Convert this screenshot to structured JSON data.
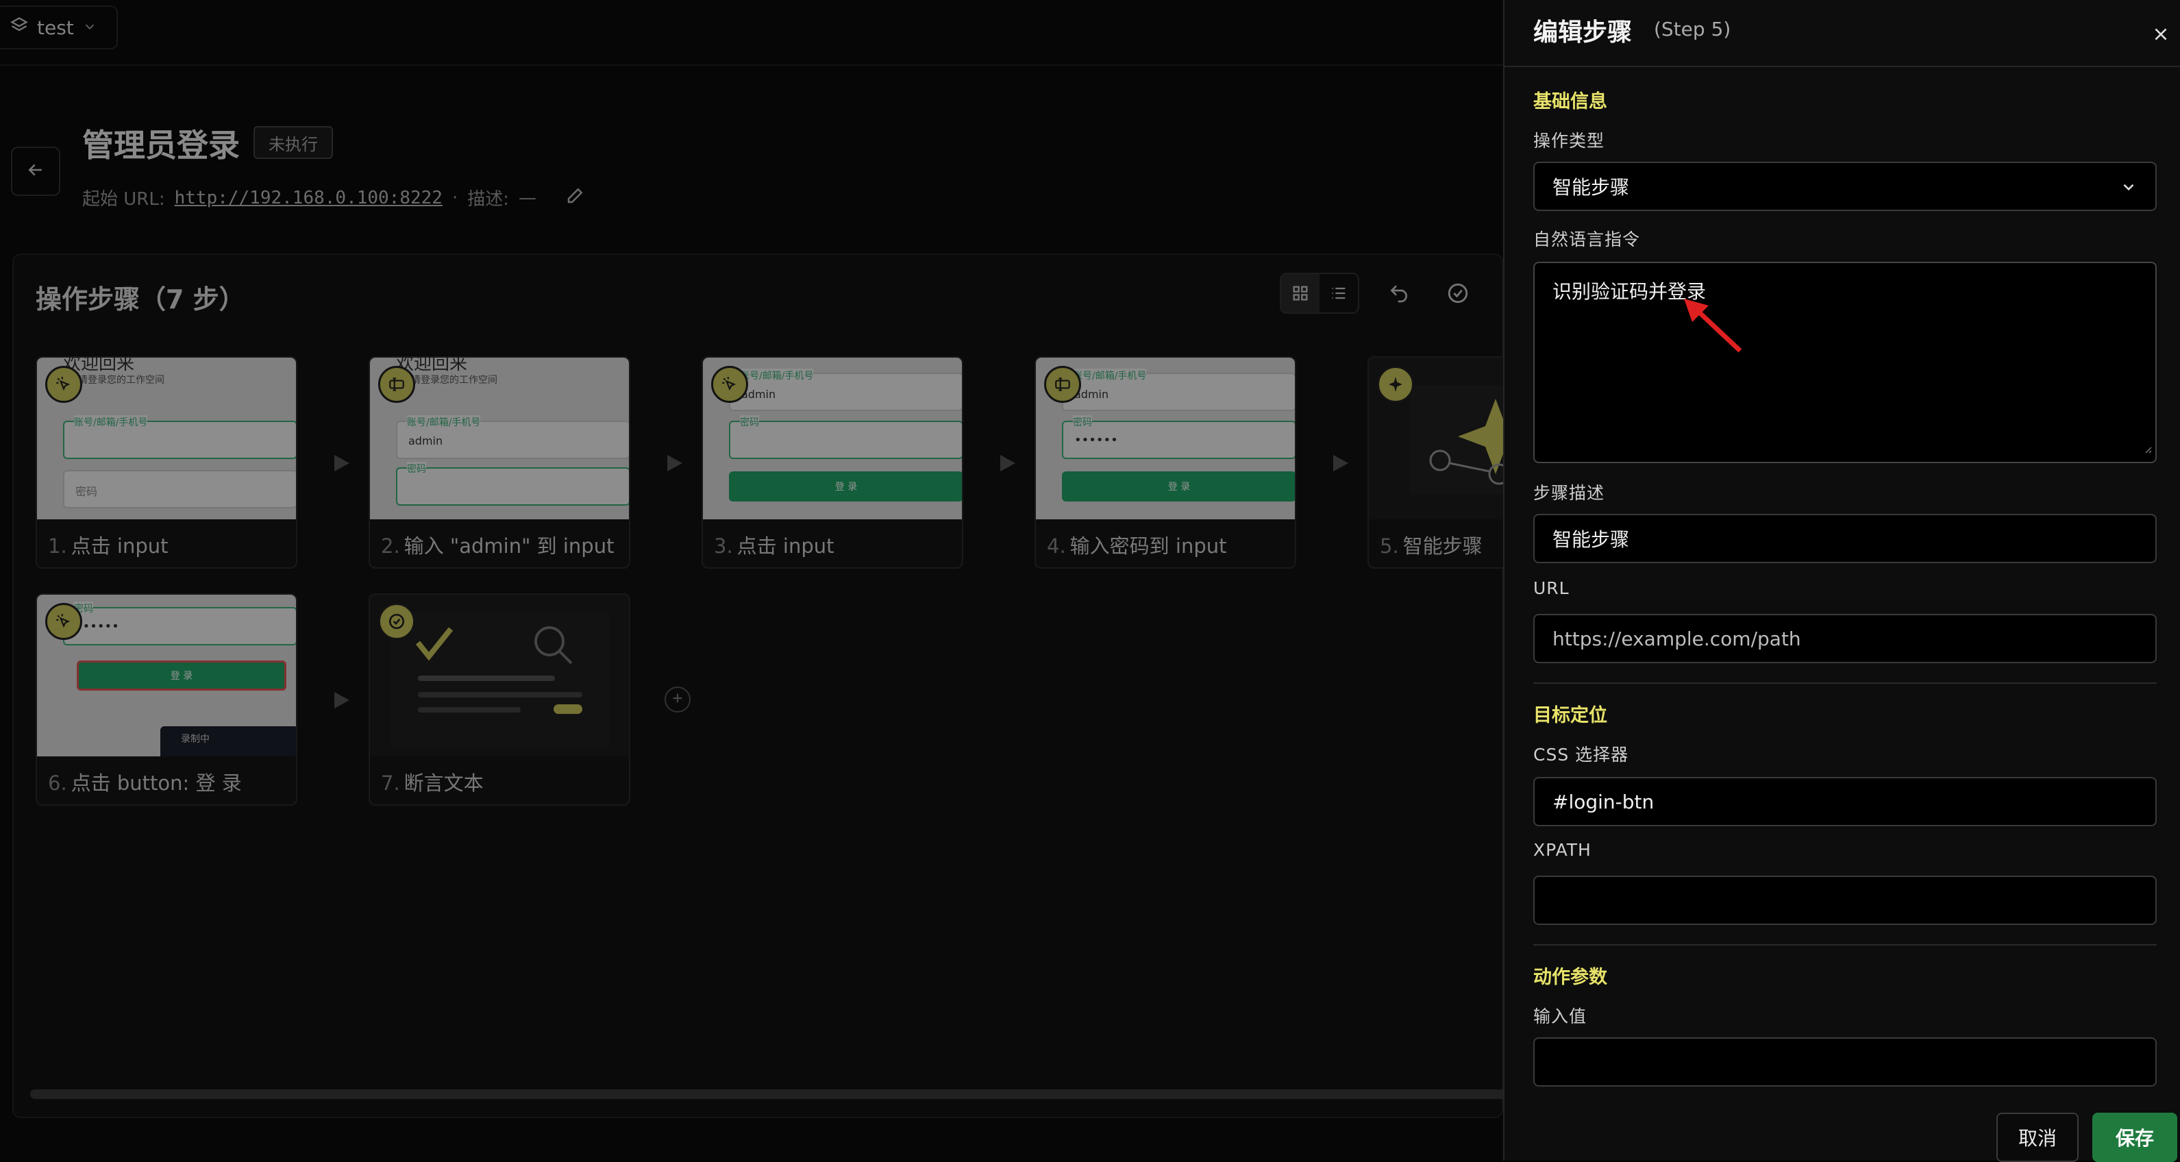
{
  "workspace": {
    "name": "test"
  },
  "page": {
    "title": "管理员登录",
    "status_badge": "未执行",
    "start_url_label": "起始 URL:",
    "start_url": "http://192.168.0.100:8222",
    "separator": "·",
    "desc_label": "描述:",
    "desc_value": "—"
  },
  "steps_panel": {
    "title": "操作步骤（7 步）",
    "steps": [
      {
        "num": "1.",
        "label": "点击 input"
      },
      {
        "num": "2.",
        "label": "输入 \"admin\" 到 input"
      },
      {
        "num": "3.",
        "label": "点击 input"
      },
      {
        "num": "4.",
        "label": "输入密码到 input"
      },
      {
        "num": "5.",
        "label": "智能步骤"
      },
      {
        "num": "6.",
        "label": "点击 button: 登 录"
      },
      {
        "num": "7.",
        "label": "断言文本"
      }
    ],
    "thumb_text": {
      "welcome": "欢迎回来",
      "workspace_sub": "请登录您的工作空间",
      "account_label": "账号/邮箱/手机号",
      "password_label": "密码",
      "password_short": "密码",
      "admin_value": "admin",
      "masked": "••••••",
      "login_btn": "登 录",
      "recording": "录制中"
    }
  },
  "drawer": {
    "title": "编辑步骤",
    "subtitle": "(Step 5)",
    "sections": {
      "basic": "基础信息",
      "target": "目标定位",
      "params": "动作参数"
    },
    "labels": {
      "op_type": "操作类型",
      "nl_instruction": "自然语言指令",
      "step_desc": "步骤描述",
      "url": "URL",
      "css": "CSS 选择器",
      "xpath": "XPATH",
      "input_value": "输入值"
    },
    "values": {
      "op_type": "智能步骤",
      "nl_instruction": "识别验证码并登录",
      "step_desc": "智能步骤",
      "url_placeholder": "https://example.com/path",
      "css": "#login-btn",
      "xpath": "",
      "input_value": ""
    },
    "buttons": {
      "cancel": "取消",
      "save": "保存"
    }
  },
  "colors": {
    "accent": "#e8e36a",
    "save": "#1f7a3e",
    "green": "#21a366",
    "badge": "#c9c45a"
  }
}
